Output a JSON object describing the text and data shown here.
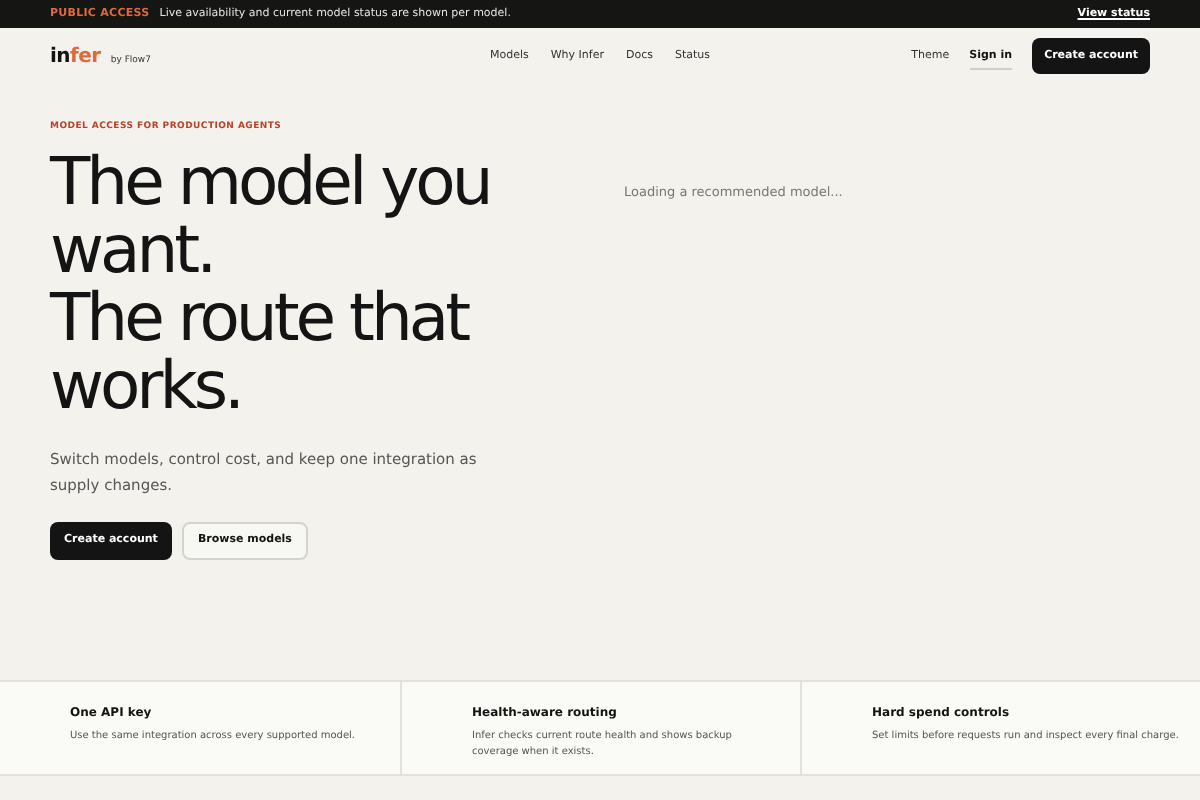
{
  "banner": {
    "badge": "PUBLIC ACCESS",
    "message": "Live availability and current model status are shown per model.",
    "link": "View status"
  },
  "header": {
    "logo": {
      "main": "in",
      "accent": "fer"
    },
    "byline": "by Flow7",
    "nav": [
      {
        "label": "Models"
      },
      {
        "label": "Why Infer"
      },
      {
        "label": "Docs"
      },
      {
        "label": "Status"
      }
    ],
    "actions": [
      {
        "label": "Theme",
        "selected": false
      },
      {
        "label": "Sign in",
        "selected": true
      }
    ],
    "cta": "Create account"
  },
  "hero": {
    "eyebrow": "MODEL ACCESS FOR PRODUCTION AGENTS",
    "headline_lines": [
      "The model you",
      "want.",
      "The route that",
      "works."
    ],
    "subtitle": "Switch models, control cost, and keep one integration as supply changes.",
    "buttons": [
      {
        "label": "Create account",
        "kind": "primary"
      },
      {
        "label": "Browse models",
        "kind": "secondary"
      }
    ],
    "status": "Loading a recommended model..."
  },
  "features": [
    {
      "title": "One API key",
      "text": "Use the same integration across every supported model."
    },
    {
      "title": "Health-aware routing",
      "text": "Infer checks current route health and shows backup coverage when it exists."
    },
    {
      "title": "Hard spend controls",
      "text": "Set limits before requests run and inspect every final charge."
    }
  ]
}
